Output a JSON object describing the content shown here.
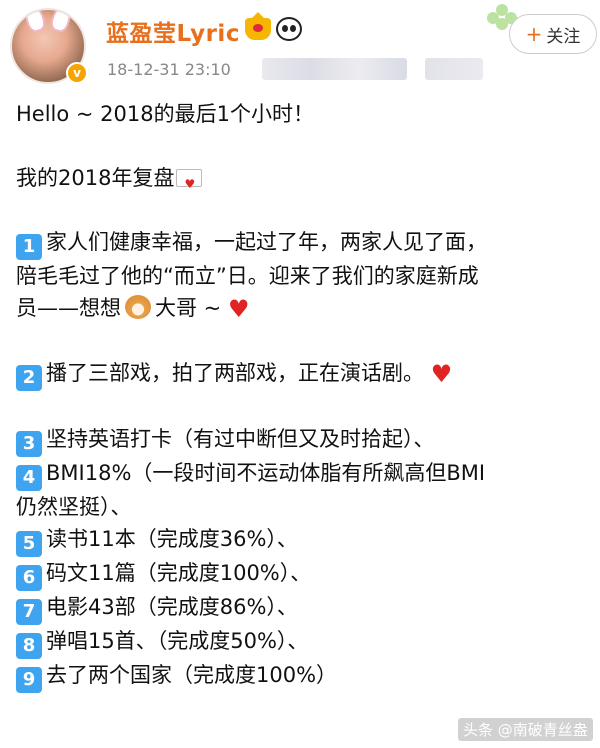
{
  "header": {
    "username": "蓝盈莹Lyric",
    "timestamp": "18-12-31 23:10",
    "follow_label": "关注",
    "follow_plus": "+",
    "verified_mark": "v"
  },
  "post": {
    "line1": "Hello ~ 2018的最后1个小时！",
    "line2": "我的2018年复盘",
    "item1_num": "1",
    "item1_a": "家人们健康幸福，一起过了年，两家人见了面，",
    "item1_b": "陪毛毛过了他的“而立”日。迎来了我们的家庭新成",
    "item1_c1": "员——想想",
    "item1_c2": "大哥 ~",
    "item2_num": "2",
    "item2": "播了三部戏，拍了两部戏，正在演话剧。",
    "item3_num": "3",
    "item3": "坚持英语打卡（有过中断但又及时拾起）、",
    "item4_num": "4",
    "item4_a": "BMI18%（一段时间不运动体脂有所飙高但BMI",
    "item4_b": "仍然坚挺）、",
    "item5_num": "5",
    "item5": "读书11本（完成度36%）、",
    "item6_num": "6",
    "item6": "码文11篇（完成度100%）、",
    "item7_num": "7",
    "item7": "电影43部（完成度86%）、",
    "item8_num": "8",
    "item8": "弹唱15首、（完成度50%）、",
    "item9_num": "9",
    "item9": "去了两个国家（完成度100%）"
  },
  "watermark": "头条 @南破青丝盎",
  "icons": {
    "heart": "♥",
    "heart_color": "#e02424",
    "number_badge_color": "#3fa4f0",
    "username_color": "#e86f1c"
  }
}
